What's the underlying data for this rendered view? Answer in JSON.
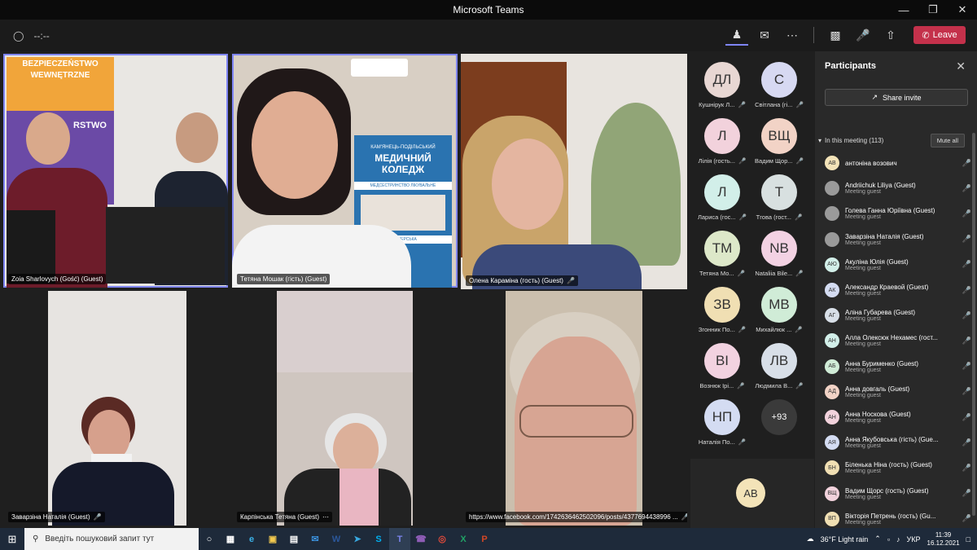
{
  "window": {
    "title": "Microsoft Teams"
  },
  "toolbar": {
    "timer": "--:--",
    "leave_label": "Leave"
  },
  "tiles": [
    {
      "name": "Zoia Sharlovych (Gość) (Guest)",
      "sign_line1": "BEZPIECZEŃSTWO",
      "sign_line2": "WEWNĘTRZNE",
      "sign_line3": "RSTWO"
    },
    {
      "name": "Тетяна Мошак (гість) (Guest)",
      "poster_line1": "КАМ'ЯНЕЦЬ-ПОДІЛЬСЬКИЙ",
      "poster_line2": "МЕДИЧНИЙ",
      "poster_line3": "КОЛЕДЖ",
      "poster_line4": "МЕДСЕСТРИНСТВО ЛІКУВАЛЬНЕ",
      "poster_line5": "АКУШЕРСЬКА"
    },
    {
      "name": "Олена Караміна (гость) (Guest)"
    },
    {
      "name": "Заварзіна Наталія (Guest)"
    },
    {
      "name": "Карпінська Тетяна (Guest)"
    },
    {
      "name": "https://www.facebook.com/1742636462502096/posts/4377694438996 ..."
    }
  ],
  "avatars": [
    {
      "initials": "ДЛ",
      "label": "Кушнірук Л...",
      "color": "#e8d7d3"
    },
    {
      "initials": "С",
      "label": "Світлана (гі...",
      "color": "#d7d9f2"
    },
    {
      "initials": "Л",
      "label": "Лілія (гость...",
      "color": "#f2d2dc"
    },
    {
      "initials": "ВЩ",
      "label": "Вадим Щор...",
      "color": "#f2d3c6"
    },
    {
      "initials": "Л",
      "label": "Лариса (гос...",
      "color": "#d2efe9"
    },
    {
      "initials": "Т",
      "label": "Тгова (гост...",
      "color": "#d8e0e0"
    },
    {
      "initials": "ТМ",
      "label": "Тетяна Мо...",
      "color": "#dde8c9"
    },
    {
      "initials": "NB",
      "label": "Nataliia Bile...",
      "color": "#f3d2e3"
    },
    {
      "initials": "ЗВ",
      "label": "Згонник По...",
      "color": "#f0dfb3"
    },
    {
      "initials": "МВ",
      "label": "Михайлюк ...",
      "color": "#d0ecd7"
    },
    {
      "initials": "ВІ",
      "label": "Вознюк Ірі...",
      "color": "#f2d2e0"
    },
    {
      "initials": "ЛВ",
      "label": "Людмила В...",
      "color": "#d8dfe8"
    },
    {
      "initials": "НП",
      "label": "Наталія По...",
      "color": "#d4dcf2"
    },
    {
      "initials": "+93",
      "label": "",
      "color": "#3a3a3a"
    }
  ],
  "self_avatar": {
    "initials": "AB",
    "color": "#f3e3b8"
  },
  "participants": {
    "title": "Participants",
    "share_invite": "Share invite",
    "in_meeting": "In this meeting (113)",
    "mute_all": "Mute all",
    "list": [
      {
        "initials": "AB",
        "name": "антоніна возович",
        "sub": "",
        "color": "#f3e3b8"
      },
      {
        "initials": "",
        "name": "Andriichuk Liliya (Guest)",
        "sub": "Meeting guest",
        "color": "#9a9a9a"
      },
      {
        "initials": "",
        "name": "Голева Ганна Юріївна (Guest)",
        "sub": "Meeting guest",
        "color": "#9a9a9a"
      },
      {
        "initials": "",
        "name": "Заварзіна Наталія (Guest)",
        "sub": "Meeting guest",
        "color": "#9a9a9a"
      },
      {
        "initials": "АЮ",
        "name": "Акуліна Юлія (Guest)",
        "sub": "Meeting guest",
        "color": "#d2efe9"
      },
      {
        "initials": "АК",
        "name": "Александр Краевой (Guest)",
        "sub": "Meeting guest",
        "color": "#d4dcf2"
      },
      {
        "initials": "АГ",
        "name": "Аліна Губарева (Guest)",
        "sub": "Meeting guest",
        "color": "#d8dfe8"
      },
      {
        "initials": "АН",
        "name": "Алла Олексюк Нехамес (гост...",
        "sub": "Meeting guest",
        "color": "#d2efe9"
      },
      {
        "initials": "АБ",
        "name": "Анна Бурименко (Guest)",
        "sub": "Meeting guest",
        "color": "#d0ecd7"
      },
      {
        "initials": "АД",
        "name": "Анна довгаль (Guest)",
        "sub": "Meeting guest",
        "color": "#f2d3c6"
      },
      {
        "initials": "АН",
        "name": "Анна Носкова (Guest)",
        "sub": "Meeting guest",
        "color": "#f2d2dc"
      },
      {
        "initials": "АЯ",
        "name": "Анна Якубовська (гість) (Gue...",
        "sub": "Meeting guest",
        "color": "#d4dcf2"
      },
      {
        "initials": "БН",
        "name": "Біленька Ніна (гость) (Guest)",
        "sub": "Meeting guest",
        "color": "#f0dfb3"
      },
      {
        "initials": "ВЩ",
        "name": "Вадим Щорс (гость) (Guest)",
        "sub": "Meeting guest",
        "color": "#f2d2dc"
      },
      {
        "initials": "ВП",
        "name": "Вікторія Петрень (гость) (Gu...",
        "sub": "Meeting guest",
        "color": "#f0dfb3"
      }
    ]
  },
  "taskbar": {
    "search_placeholder": "Введіть пошуковий запит тут",
    "weather": "36°F  Light rain",
    "lang": "УКР",
    "time": "11:39",
    "date": "16.12.2021"
  }
}
